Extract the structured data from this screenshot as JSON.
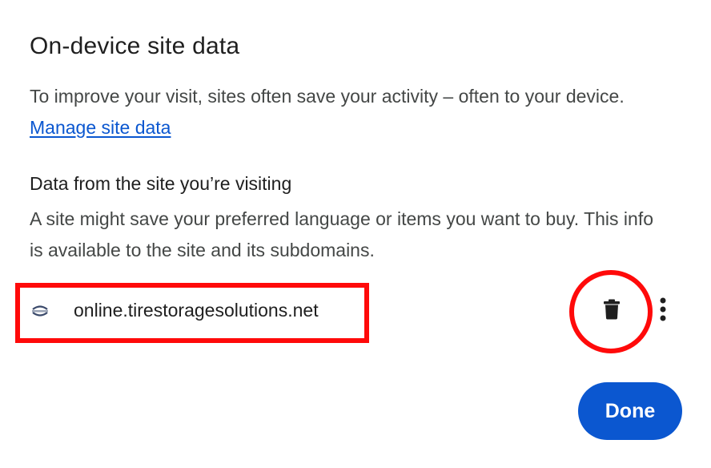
{
  "dialog": {
    "title": "On-device site data",
    "intro_text": "To improve your visit, sites often save your activity – often to your device.",
    "manage_link": "Manage site data",
    "section_title": "Data from the site you’re visiting",
    "section_description": "A site might save your preferred language or items you want to buy. This info is available to the site and its subdomains.",
    "site": {
      "name": "online.tirestoragesolutions.net",
      "favicon": "site-favicon-icon",
      "delete_icon": "trash-icon",
      "more_icon": "more-vert-icon"
    },
    "done_label": "Done"
  },
  "colors": {
    "accent": "#0b57d0",
    "annotation": "#ff0a0a",
    "text_primary": "#1f1f1f",
    "text_secondary": "#444746"
  }
}
